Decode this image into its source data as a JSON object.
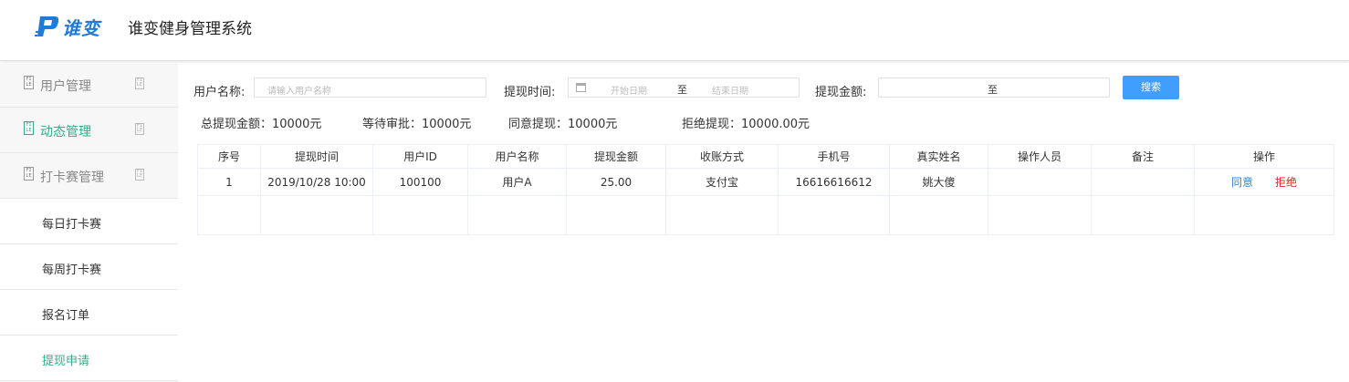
{
  "header": {
    "logo_text": "谁变",
    "system_title": "谁变健身管理系统",
    "brand_color": "#1f7bd8"
  },
  "sidebar": {
    "items": [
      {
        "label": "用户管理",
        "icon": "file-icon",
        "active": false
      },
      {
        "label": "动态管理",
        "icon": "file-icon",
        "active": true
      },
      {
        "label": "打卡赛管理",
        "icon": "file-icon",
        "active": false
      }
    ],
    "sub_items": [
      {
        "label": "每日打卡赛"
      },
      {
        "label": "每周打卡赛"
      },
      {
        "label": "报名订单"
      },
      {
        "label": "提现申请",
        "current": true
      }
    ],
    "active_color": "#2fae8a"
  },
  "filters": {
    "username_label": "用户名称:",
    "username_placeholder": "请输入用户名称",
    "username_value": "",
    "time_label": "提现时间:",
    "start_date_placeholder": "开始日期",
    "date_separator": "至",
    "end_date_placeholder": "结束日期",
    "amount_label": "提现金额:",
    "amount_separator": "至",
    "search_button": "搜索"
  },
  "stats": {
    "total": "总提现金额：10000元",
    "pending": "等待审批：10000元",
    "approved": "同意提现：10000元",
    "rejected": "拒绝提现：10000.00元"
  },
  "table": {
    "headers": [
      "序号",
      "提现时间",
      "用户ID",
      "用户名称",
      "提现金额",
      "收账方式",
      "手机号",
      "真实姓名",
      "操作人员",
      "备注",
      "操作"
    ],
    "rows": [
      {
        "index": "1",
        "time": "2019/10/28 10:00",
        "user_id": "100100",
        "username": "用户A",
        "amount": "25.00",
        "method": "支付宝",
        "phone": "16616616612",
        "real_name": "姚大傻",
        "operator": "",
        "remark": "",
        "agree_label": "同意",
        "reject_label": "拒绝"
      }
    ]
  },
  "colors": {
    "primary_button": "#409eff",
    "agree_link": "#2f86d8",
    "reject_link": "#e32222"
  }
}
